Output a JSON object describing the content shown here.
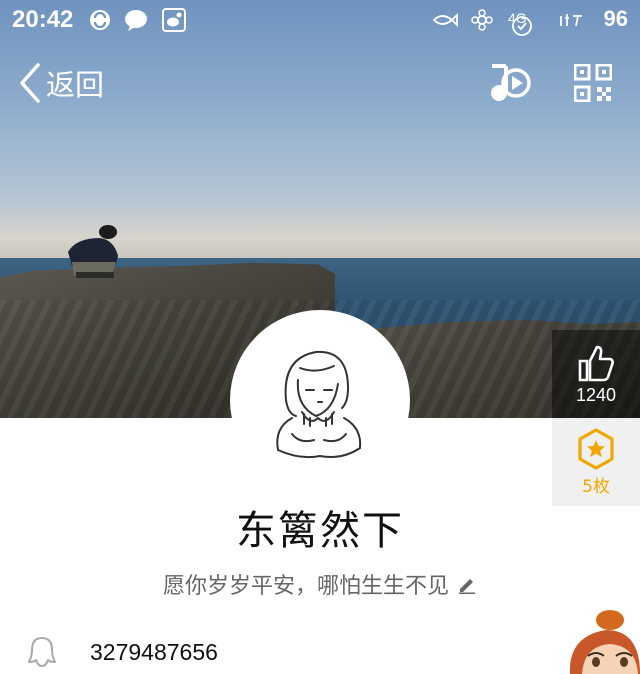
{
  "status_bar": {
    "time": "20:42",
    "network": "4G",
    "battery": "96",
    "icons": [
      "sync-icon",
      "chat-icon",
      "weibo-icon",
      "fish-icon",
      "flower-icon",
      "signal-icon",
      "carrier-icon"
    ]
  },
  "nav": {
    "back_label": "返回",
    "music_icon": "music-play-icon",
    "qr_icon": "qr-code-icon"
  },
  "profile": {
    "nickname": "东篱然下",
    "signature": "愿你岁岁平安，哪怕生生不见",
    "qq_number": "3279487656"
  },
  "likes": {
    "count": "1240"
  },
  "medals": {
    "count": "5枚"
  },
  "colors": {
    "medal": "#f0a800",
    "panel_dark": "#00000073"
  }
}
